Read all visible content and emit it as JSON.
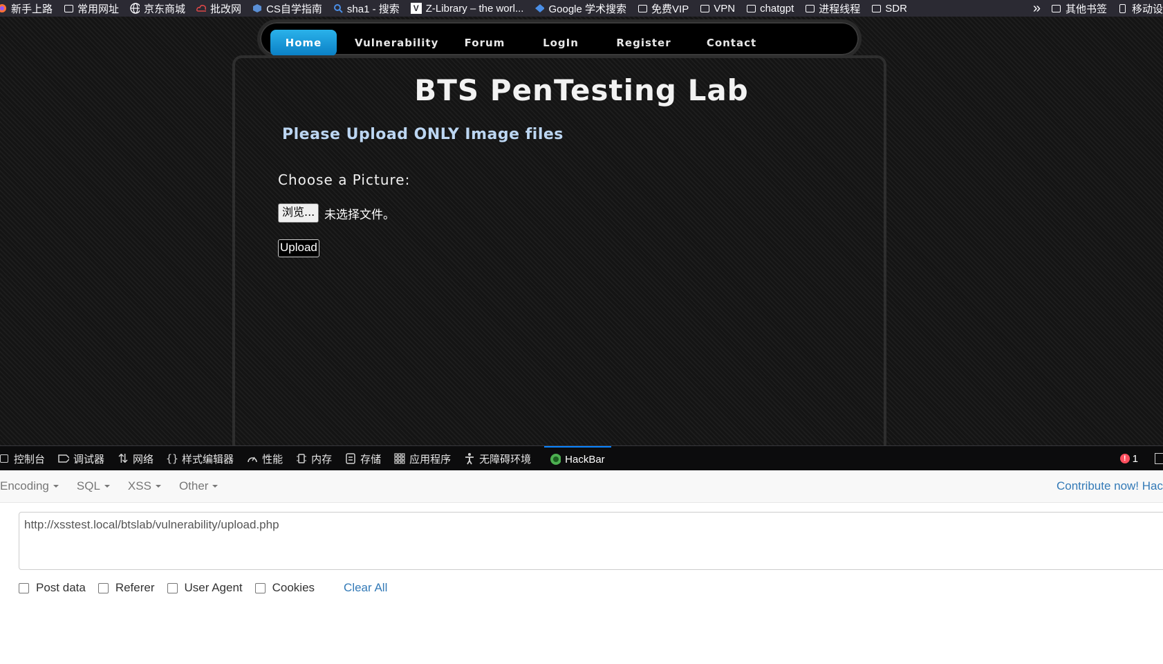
{
  "bookmarks": {
    "items": [
      {
        "label": "新手上路",
        "icon": "firefox-icon"
      },
      {
        "label": "常用网址",
        "icon": "folder-icon"
      },
      {
        "label": "京东商城",
        "icon": "globe-icon"
      },
      {
        "label": "批改网",
        "icon": "cloud-icon"
      },
      {
        "label": "CS自学指南",
        "icon": "cube-icon"
      },
      {
        "label": "sha1 - 搜索",
        "icon": "search-icon"
      },
      {
        "label": "Z-Library – the worl...",
        "icon": "zlibrary-icon"
      },
      {
        "label": "Google 学术搜索",
        "icon": "scholar-icon"
      },
      {
        "label": "免费VIP",
        "icon": "folder-icon"
      },
      {
        "label": "VPN",
        "icon": "folder-icon"
      },
      {
        "label": "chatgpt",
        "icon": "folder-icon"
      },
      {
        "label": "进程线程",
        "icon": "folder-icon"
      },
      {
        "label": "SDR",
        "icon": "folder-icon"
      }
    ],
    "overflow_label": "»",
    "other_bookmarks": "其他书签",
    "mobile_bookmarks": "移动设"
  },
  "site": {
    "nav": [
      "Home",
      "Vulnerability",
      "Forum",
      "LogIn",
      "Register",
      "Contact"
    ],
    "active_nav": "Home",
    "title": "BTS PenTesting Lab",
    "subtitle": "Please Upload ONLY Image files",
    "choose_label": "Choose a Picture:",
    "browse_label": "浏览...",
    "no_file_label": "未选择文件。",
    "upload_label": "Upload"
  },
  "devtools": {
    "tabs": [
      {
        "label": "控制台",
        "icon": "console-icon"
      },
      {
        "label": "调试器",
        "icon": "debugger-icon"
      },
      {
        "label": "网络",
        "icon": "network-icon"
      },
      {
        "label": "样式编辑器",
        "icon": "style-editor-icon"
      },
      {
        "label": "性能",
        "icon": "performance-icon"
      },
      {
        "label": "内存",
        "icon": "memory-icon"
      },
      {
        "label": "存储",
        "icon": "storage-icon"
      },
      {
        "label": "应用程序",
        "icon": "application-icon"
      },
      {
        "label": "无障碍环境",
        "icon": "accessibility-icon"
      },
      {
        "label": "HackBar",
        "icon": "hackbar-icon"
      }
    ],
    "active_tab": "HackBar",
    "error_count": "1"
  },
  "hackbar": {
    "menus": [
      "Encoding",
      "SQL",
      "XSS",
      "Other"
    ],
    "contribute": "Contribute now! Hac",
    "url": "http://xsstest.local/btslab/vulnerability/upload.php",
    "options": [
      "Post data",
      "Referer",
      "User Agent",
      "Cookies"
    ],
    "clear_all": "Clear All"
  }
}
